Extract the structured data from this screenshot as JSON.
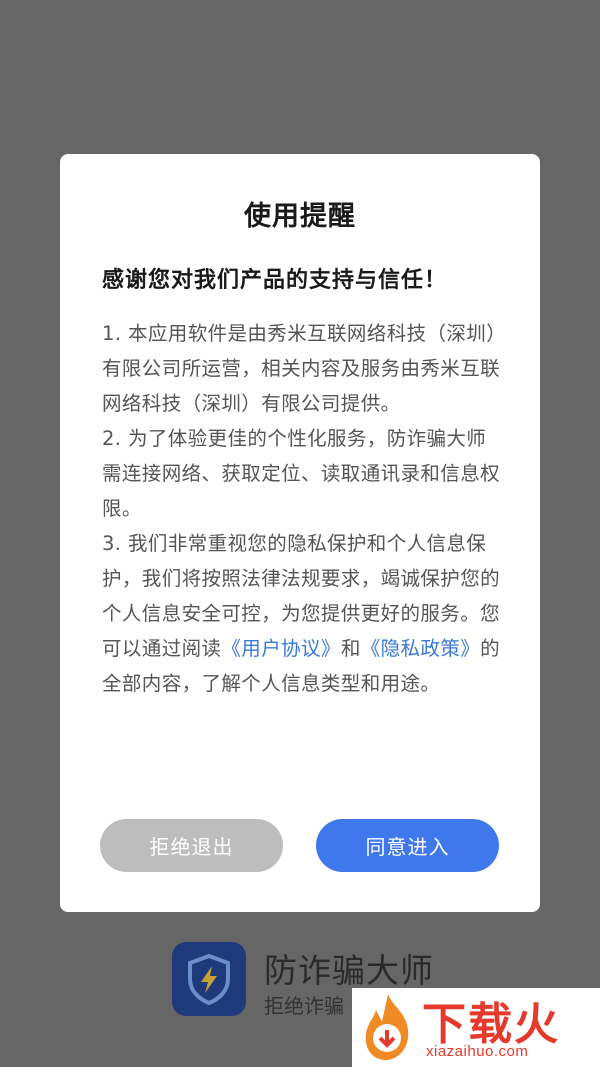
{
  "background_app": {
    "name": "防诈骗大师",
    "slogan": "拒绝诈骗 安"
  },
  "dialog": {
    "title": "使用提醒",
    "subtitle": "感谢您对我们产品的支持与信任！",
    "paragraph1": "1. 本应用软件是由秀米互联网络科技（深圳）有限公司所运营，相关内容及服务由秀米互联网络科技（深圳）有限公司提供。",
    "paragraph2": "2. 为了体验更佳的个性化服务，防诈骗大师需连接网络、获取定位、读取通讯录和信息权限。",
    "paragraph3_part1": "3. 我们非常重视您的隐私保护和个人信息保护，我们将按照法律法规要求，竭诚保护您的个人信息安全可控，为您提供更好的服务。您可以通过阅读",
    "user_agreement_link": "《用户协议》",
    "and_text": "和",
    "privacy_policy_link": "《隐私政策》",
    "paragraph3_part2": "的全部内容，了解个人信息类型和用途。",
    "reject_button": "拒绝退出",
    "agree_button": "同意进入"
  },
  "watermark": {
    "brand": "下载火",
    "url": "xiazaihuo.com"
  },
  "colors": {
    "overlay_bg": "#666666",
    "agree_button": "#3f78ec",
    "reject_button": "#bdbdbd",
    "link": "#3a78d8",
    "watermark_red": "#e5392b"
  }
}
